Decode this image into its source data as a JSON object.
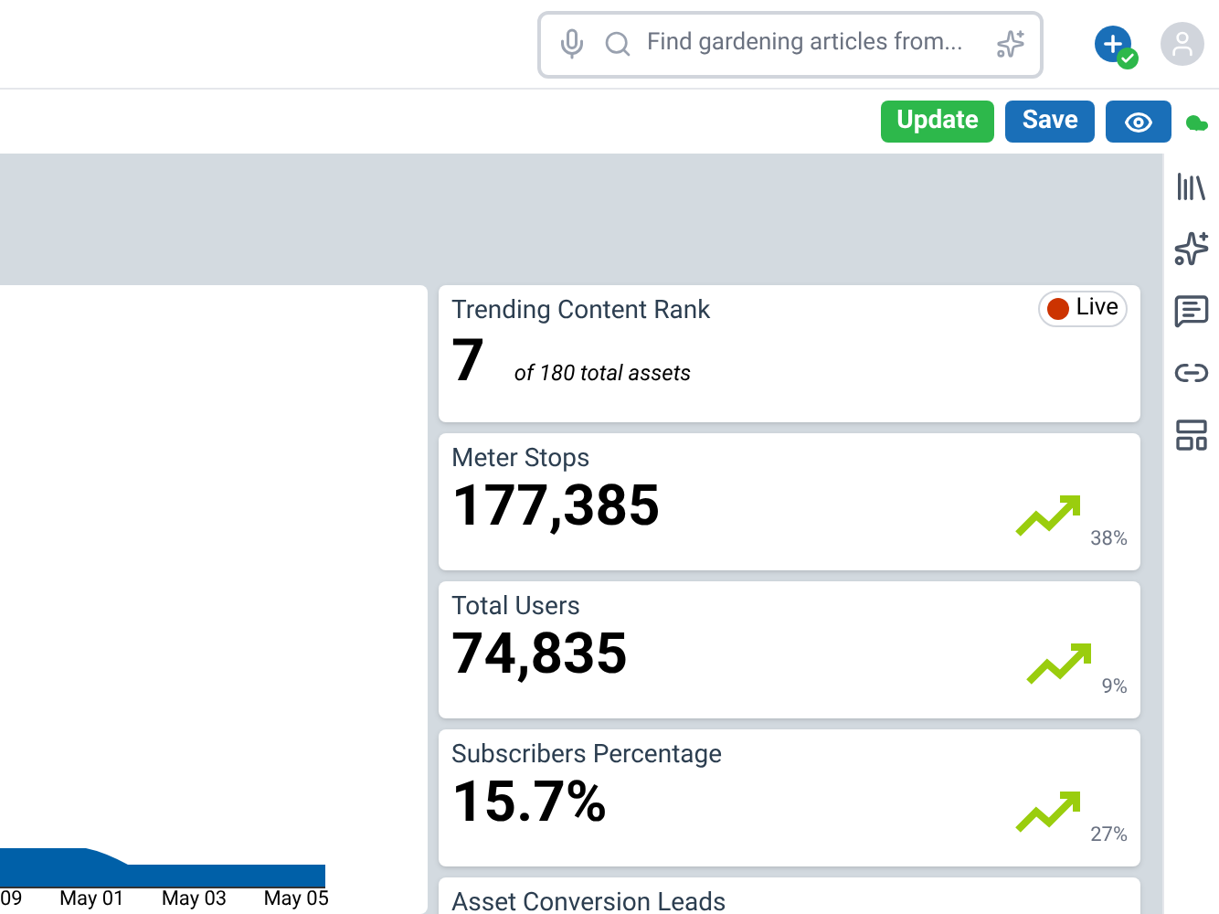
{
  "search": {
    "placeholder": "Find gardening articles from..."
  },
  "toolbar": {
    "buttons": [
      {
        "label": "Update",
        "kind": "update"
      },
      {
        "label": "Save",
        "kind": "save"
      }
    ]
  },
  "chart": {
    "axis_labels": [
      "09",
      "May 01",
      "May 03",
      "May 05"
    ]
  },
  "cards": [
    {
      "kind": "rank",
      "title": "Trending Content Rank",
      "value": "7",
      "note": "of 180 total assets",
      "badge": "Live",
      "color": "#cc3300"
    },
    {
      "kind": "metric",
      "title": "Meter Stops",
      "value": "177,385",
      "change": "38%"
    },
    {
      "kind": "metric",
      "title": "Total Users",
      "value": "74,835",
      "change": "9%"
    },
    {
      "kind": "metric",
      "title": "Subscribers Percentage",
      "value": "15.7%",
      "change": "27%"
    },
    {
      "kind": "metric",
      "title": "Asset Conversion Leads"
    }
  ]
}
